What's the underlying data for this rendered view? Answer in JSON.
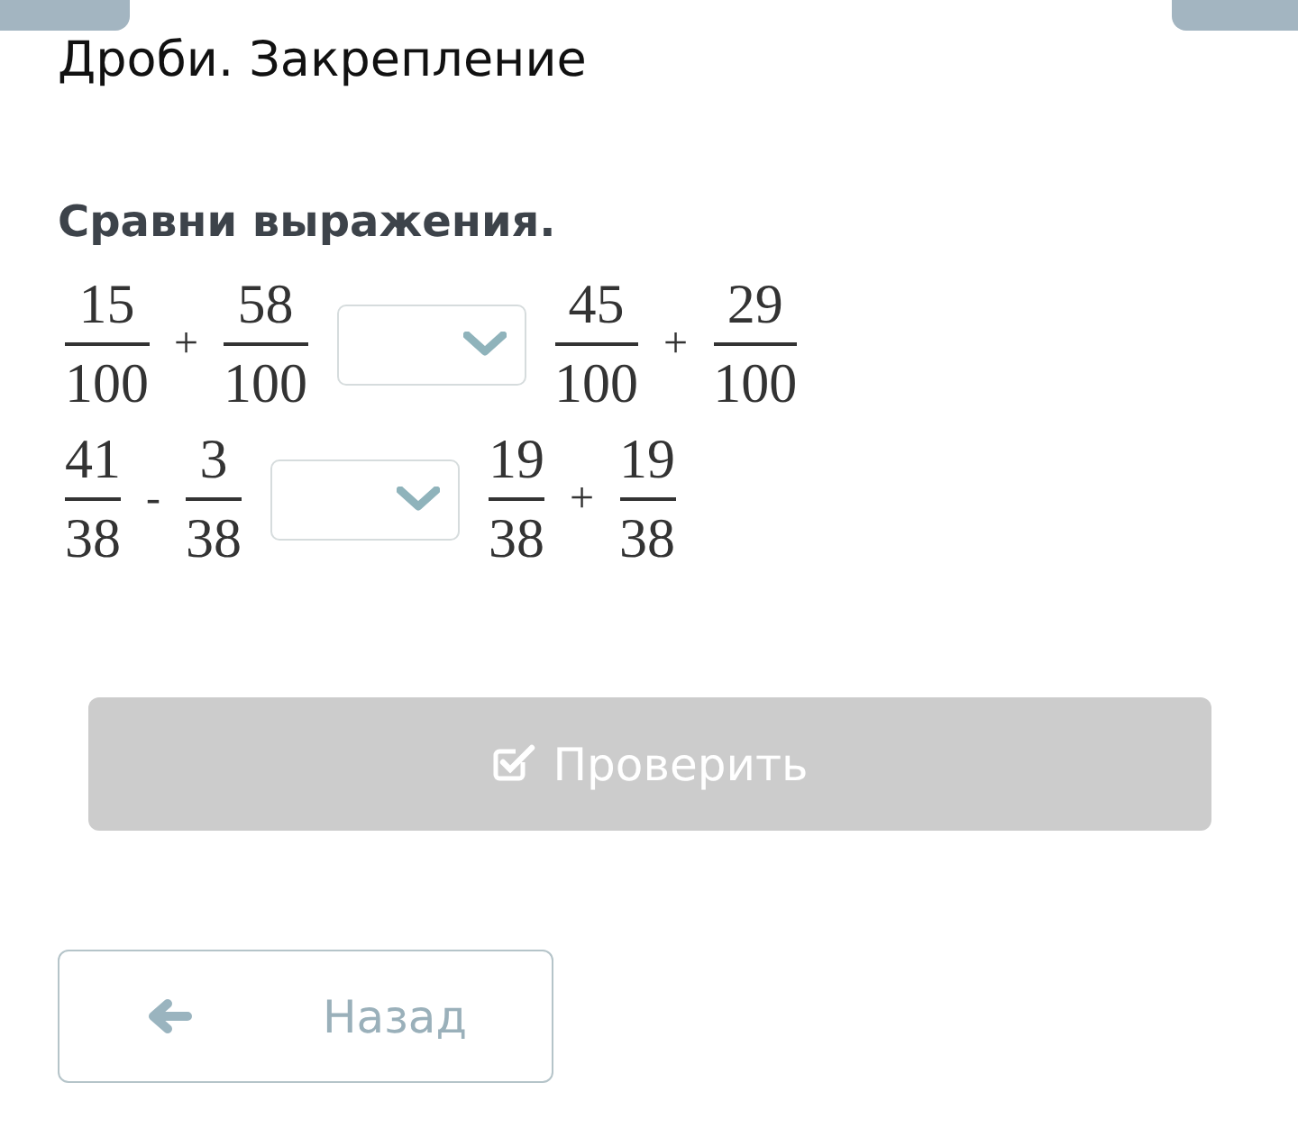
{
  "title": "Дроби. Закрепление",
  "prompt": "Сравни выражения.",
  "rows": [
    {
      "terms": [
        {
          "kind": "fraction",
          "numerator": "15",
          "denominator": "100"
        },
        {
          "kind": "operator",
          "symbol": "+"
        },
        {
          "kind": "fraction",
          "numerator": "58",
          "denominator": "100"
        },
        {
          "kind": "select"
        },
        {
          "kind": "fraction",
          "numerator": "45",
          "denominator": "100"
        },
        {
          "kind": "operator",
          "symbol": "+"
        },
        {
          "kind": "fraction",
          "numerator": "29",
          "denominator": "100"
        }
      ]
    },
    {
      "terms": [
        {
          "kind": "fraction",
          "numerator": "41",
          "denominator": "38"
        },
        {
          "kind": "operator",
          "symbol": "-"
        },
        {
          "kind": "fraction",
          "numerator": "3",
          "denominator": "38"
        },
        {
          "kind": "select"
        },
        {
          "kind": "fraction",
          "numerator": "19",
          "denominator": "38"
        },
        {
          "kind": "operator",
          "symbol": "+"
        },
        {
          "kind": "fraction",
          "numerator": "19",
          "denominator": "38"
        }
      ]
    }
  ],
  "check_button": {
    "label": "Проверить",
    "disabled": true
  },
  "back_button": {
    "label": "Назад"
  }
}
